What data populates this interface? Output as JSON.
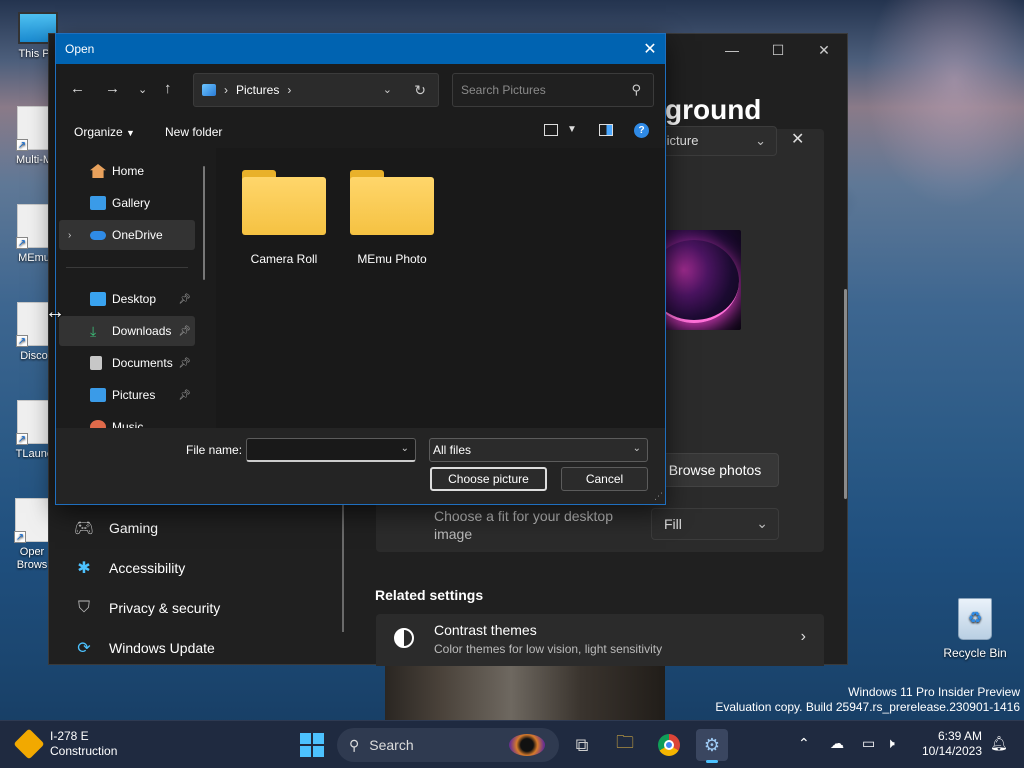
{
  "desktop": {
    "icons": [
      {
        "label": "This PC"
      },
      {
        "label": "Multi-M"
      },
      {
        "label": "MEmu"
      },
      {
        "label": "Disco"
      },
      {
        "label": "TLaunc"
      },
      {
        "label": "Oper Brows"
      }
    ],
    "recycle_bin": "Recycle Bin",
    "watermark_line1": "Windows 11 Pro Insider Preview",
    "watermark_line2": "Evaluation copy. Build 25947.rs_prerelease.230901-1416"
  },
  "settings": {
    "heading_fragment": "ground",
    "picture_select": "Picture",
    "browse_photos": "Browse photos",
    "fit_label": "Choose a fit for your desktop image",
    "fit_value": "Fill",
    "related_settings": "Related settings",
    "contrast_title": "Contrast themes",
    "contrast_desc": "Color themes for low vision, light sensitivity",
    "nav": [
      {
        "label": "Gaming",
        "icon": "gamepad-icon"
      },
      {
        "label": "Accessibility",
        "icon": "accessibility-icon"
      },
      {
        "label": "Privacy & security",
        "icon": "shield-icon"
      },
      {
        "label": "Windows Update",
        "icon": "update-icon"
      }
    ]
  },
  "dialog": {
    "title": "Open",
    "address": "Pictures",
    "search_placeholder": "Search Pictures",
    "organize": "Organize",
    "new_folder": "New folder",
    "nav": [
      {
        "label": "Home",
        "icon": "home-icon",
        "color": "#e8a15c"
      },
      {
        "label": "Gallery",
        "icon": "gallery-icon",
        "color": "#3a9be8"
      },
      {
        "label": "OneDrive",
        "icon": "onedrive-icon",
        "color": "#2f8be6"
      },
      {
        "label": "Desktop",
        "icon": "desktop-icon",
        "color": "#39a3f0"
      },
      {
        "label": "Downloads",
        "icon": "downloads-icon",
        "color": "#3cc27a"
      },
      {
        "label": "Documents",
        "icon": "documents-icon",
        "color": "#c7c7c7"
      },
      {
        "label": "Pictures",
        "icon": "pictures-icon",
        "color": "#3a9be8"
      },
      {
        "label": "Music",
        "icon": "music-icon",
        "color": "#e06a4a"
      }
    ],
    "folders": [
      {
        "label": "Camera Roll"
      },
      {
        "label": "MEmu Photo"
      }
    ],
    "file_name_label": "File name:",
    "file_name_value": "",
    "filter": "All files",
    "choose_button": "Choose picture",
    "cancel_button": "Cancel"
  },
  "taskbar": {
    "weather_title": "I-278 E",
    "weather_sub": "Construction",
    "search": "Search",
    "time": "6:39 AM",
    "date": "10/14/2023"
  }
}
